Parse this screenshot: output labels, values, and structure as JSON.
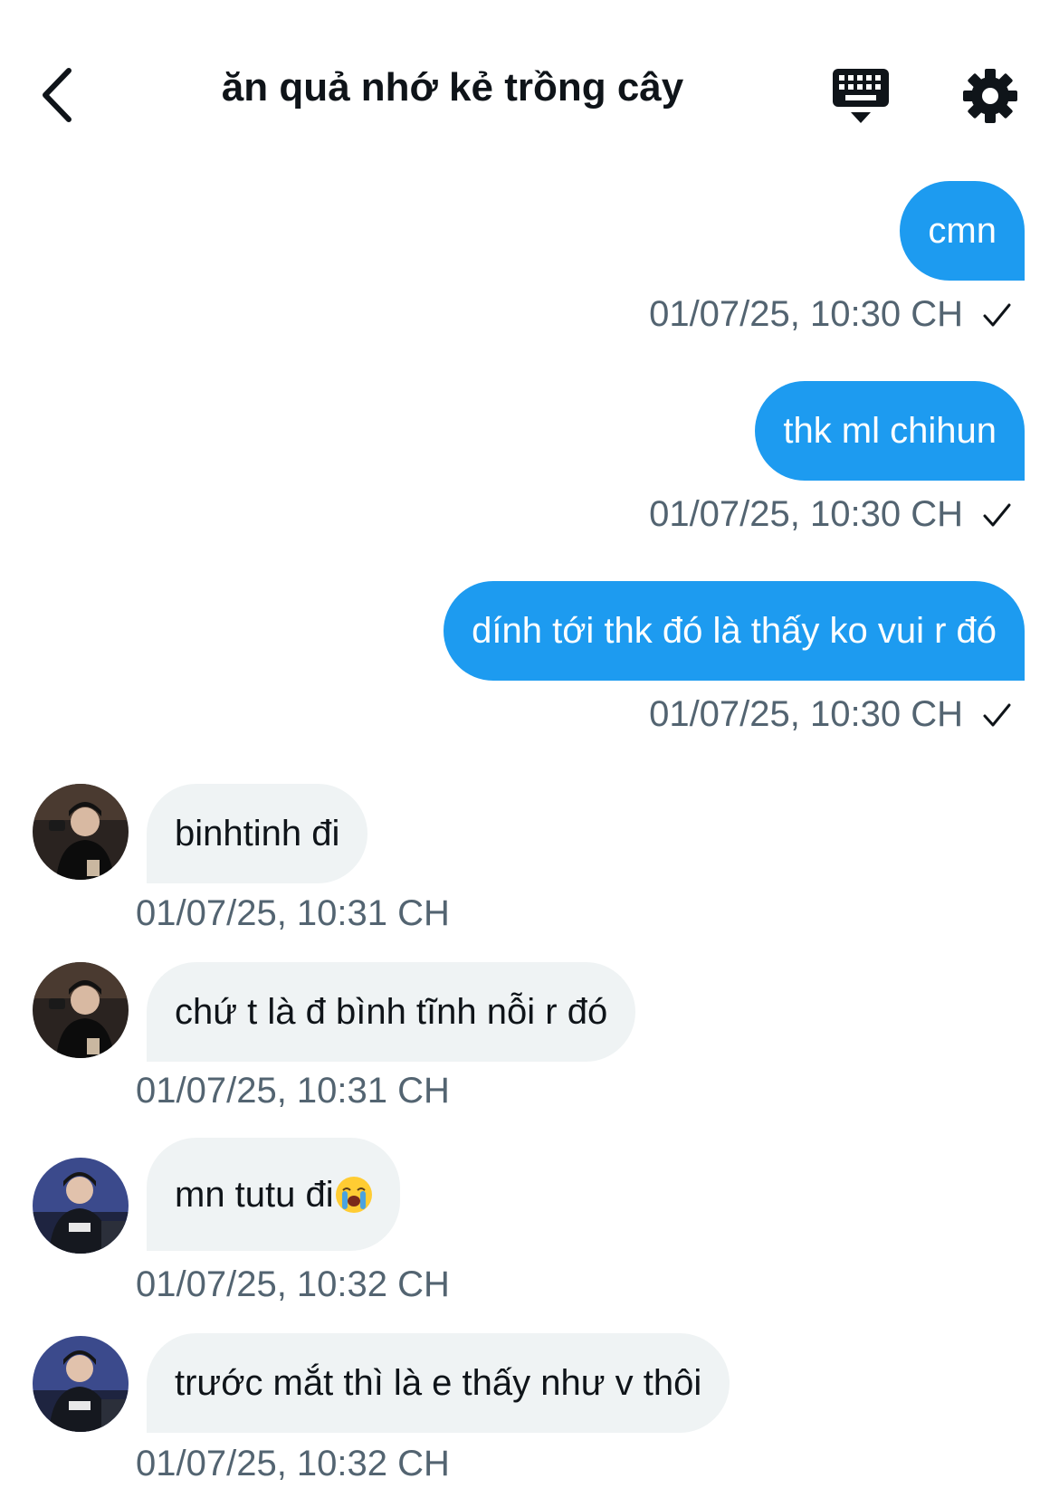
{
  "header": {
    "title": "ăn quả nhớ kẻ trồng cây",
    "back_icon": "chevron-left-icon",
    "keyboard_icon": "keyboard-icon",
    "settings_icon": "gear-icon"
  },
  "colors": {
    "outgoing_bubble": "#1d9bf0",
    "incoming_bubble": "#eff3f4",
    "timestamp": "#536471",
    "title": "#0f1419"
  },
  "messages": [
    {
      "direction": "out",
      "text": "cmn",
      "time": "01/07/25, 10:30 CH",
      "status_icon": "check-icon"
    },
    {
      "direction": "out",
      "text": "thk ml chihun",
      "time": "01/07/25, 10:30 CH",
      "status_icon": "check-icon"
    },
    {
      "direction": "out",
      "text": "dính tới thk đó là thấy ko vui r đó",
      "time": "01/07/25, 10:30 CH",
      "status_icon": "check-icon"
    },
    {
      "direction": "in",
      "text": "binhtinh đi",
      "time": "01/07/25, 10:31 CH",
      "avatar_icon": "avatar"
    },
    {
      "direction": "in",
      "text": "chứ t là đ bình tĩnh nỗi r đó",
      "time": "01/07/25, 10:31 CH",
      "avatar_icon": "avatar"
    },
    {
      "direction": "in",
      "text": "mn tutu đi",
      "emoji": "loudly-crying-face-icon",
      "time": "01/07/25, 10:32 CH",
      "avatar_icon": "avatar"
    },
    {
      "direction": "in",
      "text": "trước mắt thì là e thấy như v thôi",
      "time": "01/07/25, 10:32 CH",
      "avatar_icon": "avatar"
    }
  ]
}
